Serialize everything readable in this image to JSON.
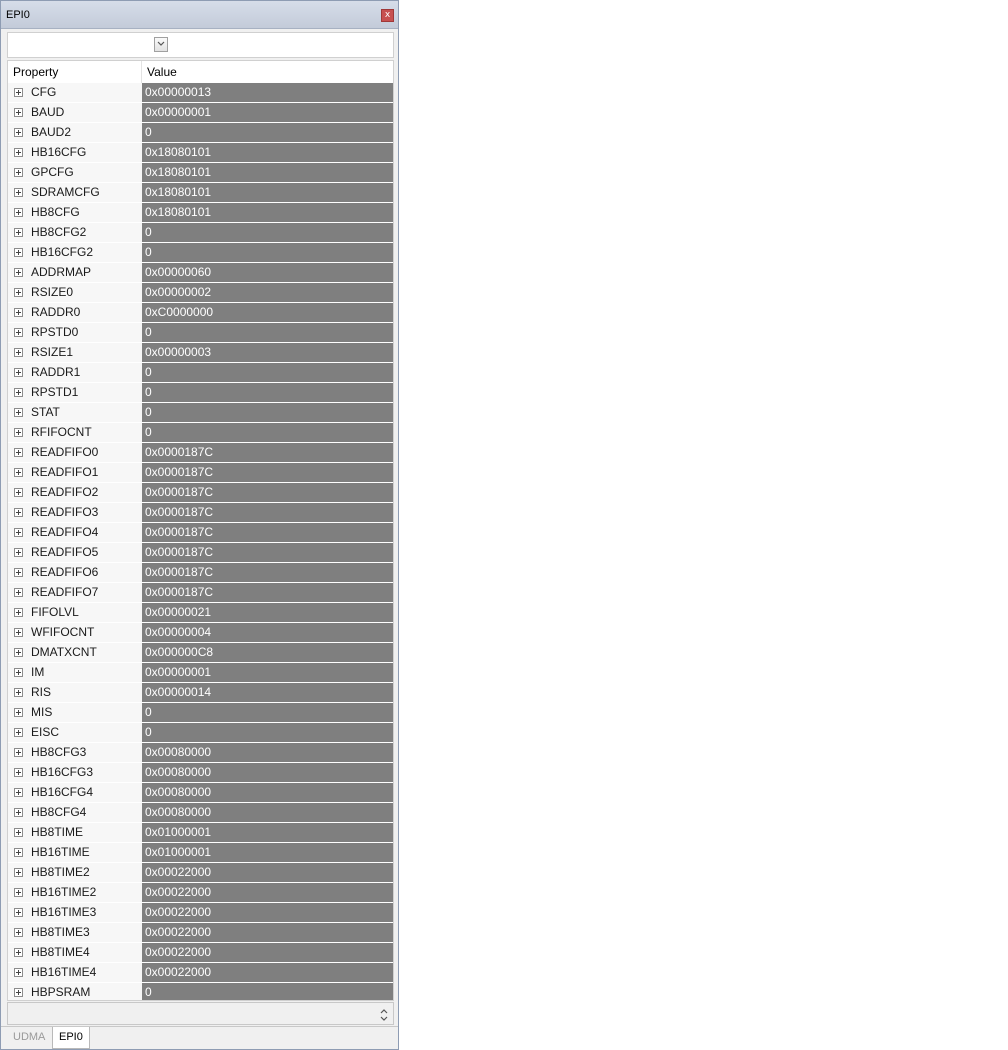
{
  "window": {
    "title": "EPI0",
    "close_glyph": "x"
  },
  "grid": {
    "columns": [
      "Property",
      "Value"
    ],
    "rows": [
      {
        "name": "CFG",
        "value": "0x00000013"
      },
      {
        "name": "BAUD",
        "value": "0x00000001"
      },
      {
        "name": "BAUD2",
        "value": "0"
      },
      {
        "name": "HB16CFG",
        "value": "0x18080101"
      },
      {
        "name": "GPCFG",
        "value": "0x18080101"
      },
      {
        "name": "SDRAMCFG",
        "value": "0x18080101"
      },
      {
        "name": "HB8CFG",
        "value": "0x18080101"
      },
      {
        "name": "HB8CFG2",
        "value": "0"
      },
      {
        "name": "HB16CFG2",
        "value": "0"
      },
      {
        "name": "ADDRMAP",
        "value": "0x00000060"
      },
      {
        "name": "RSIZE0",
        "value": "0x00000002"
      },
      {
        "name": "RADDR0",
        "value": "0xC0000000"
      },
      {
        "name": "RPSTD0",
        "value": "0"
      },
      {
        "name": "RSIZE1",
        "value": "0x00000003"
      },
      {
        "name": "RADDR1",
        "value": "0"
      },
      {
        "name": "RPSTD1",
        "value": "0"
      },
      {
        "name": "STAT",
        "value": "0"
      },
      {
        "name": "RFIFOCNT",
        "value": "0"
      },
      {
        "name": "READFIFO0",
        "value": "0x0000187C"
      },
      {
        "name": "READFIFO1",
        "value": "0x0000187C"
      },
      {
        "name": "READFIFO2",
        "value": "0x0000187C"
      },
      {
        "name": "READFIFO3",
        "value": "0x0000187C"
      },
      {
        "name": "READFIFO4",
        "value": "0x0000187C"
      },
      {
        "name": "READFIFO5",
        "value": "0x0000187C"
      },
      {
        "name": "READFIFO6",
        "value": "0x0000187C"
      },
      {
        "name": "READFIFO7",
        "value": "0x0000187C"
      },
      {
        "name": "FIFOLVL",
        "value": "0x00000021"
      },
      {
        "name": "WFIFOCNT",
        "value": "0x00000004"
      },
      {
        "name": "DMATXCNT",
        "value": "0x000000C8"
      },
      {
        "name": "IM",
        "value": "0x00000001"
      },
      {
        "name": "RIS",
        "value": "0x00000014"
      },
      {
        "name": "MIS",
        "value": "0"
      },
      {
        "name": "EISC",
        "value": "0"
      },
      {
        "name": "HB8CFG3",
        "value": "0x00080000"
      },
      {
        "name": "HB16CFG3",
        "value": "0x00080000"
      },
      {
        "name": "HB16CFG4",
        "value": "0x00080000"
      },
      {
        "name": "HB8CFG4",
        "value": "0x00080000"
      },
      {
        "name": "HB8TIME",
        "value": "0x01000001"
      },
      {
        "name": "HB16TIME",
        "value": "0x01000001"
      },
      {
        "name": "HB8TIME2",
        "value": "0x00022000"
      },
      {
        "name": "HB16TIME2",
        "value": "0x00022000"
      },
      {
        "name": "HB16TIME3",
        "value": "0x00022000"
      },
      {
        "name": "HB8TIME3",
        "value": "0x00022000"
      },
      {
        "name": "HB8TIME4",
        "value": "0x00022000"
      },
      {
        "name": "HB16TIME4",
        "value": "0x00022000"
      },
      {
        "name": "HBPSRAM",
        "value": "0"
      }
    ]
  },
  "tabs": [
    {
      "label": "UDMA",
      "active": false
    },
    {
      "label": "EPI0",
      "active": true
    }
  ],
  "colors": {
    "value_cell_bg": "#7f7f7f",
    "value_text": "#ffffff",
    "name_cell_bg": "#f7f7f7"
  },
  "icons": {
    "expander": "plus-box-icon",
    "combo": "chevron-down-icon",
    "scroll": "up-down-arrows-icon"
  }
}
